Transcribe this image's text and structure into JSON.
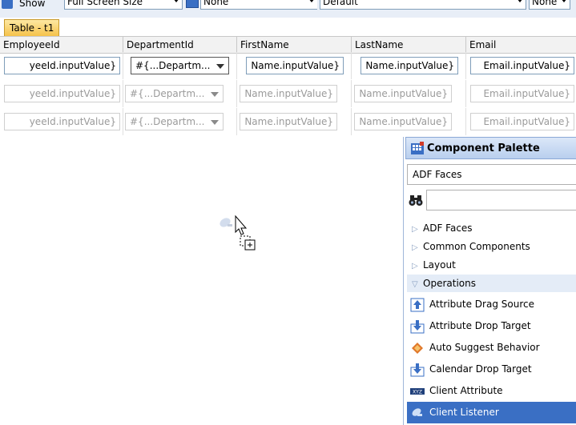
{
  "toolbar": {
    "show_label": "Show",
    "screen_size": "Full Screen Size",
    "skin": "None",
    "default_select": "Default",
    "right_select": "None"
  },
  "table_tab": "Table - t1",
  "columns": [
    "EmployeeId",
    "DepartmentId",
    "FirstName",
    "LastName",
    "Email"
  ],
  "rows": [
    [
      "yeeId.inputValue}",
      "#{...Departm...",
      "Name.inputValue}",
      "Name.inputValue}",
      "Email.inputValue}"
    ],
    [
      "yeeId.inputValue}",
      "#{...Departm...",
      "Name.inputValue}",
      "Name.inputValue}",
      "Email.inputValue}"
    ],
    [
      "yeeId.inputValue}",
      "#{...Departm...",
      "Name.inputValue}",
      "Name.inputValue}",
      "Email.inputValue}"
    ]
  ],
  "palette": {
    "title": "Component Palette",
    "library": "ADF Faces",
    "categories": [
      {
        "label": "ADF Faces",
        "open": false
      },
      {
        "label": "Common Components",
        "open": false
      },
      {
        "label": "Layout",
        "open": false
      },
      {
        "label": "Operations",
        "open": true
      }
    ],
    "items": [
      {
        "label": "Attribute Drag Source",
        "icon": "attribute-drag-source-icon",
        "selected": false
      },
      {
        "label": "Attribute Drop Target",
        "icon": "attribute-drop-target-icon",
        "selected": false
      },
      {
        "label": "Auto Suggest Behavior",
        "icon": "auto-suggest-icon",
        "selected": false
      },
      {
        "label": "Calendar Drop Target",
        "icon": "calendar-drop-target-icon",
        "selected": false
      },
      {
        "label": "Client Attribute",
        "icon": "client-attribute-icon",
        "selected": false
      },
      {
        "label": "Client Listener",
        "icon": "client-listener-icon",
        "selected": true
      }
    ]
  },
  "colors": {
    "selection": "#3a6fc4",
    "tab": "#f5c24a",
    "header": "#f2f2f2"
  }
}
